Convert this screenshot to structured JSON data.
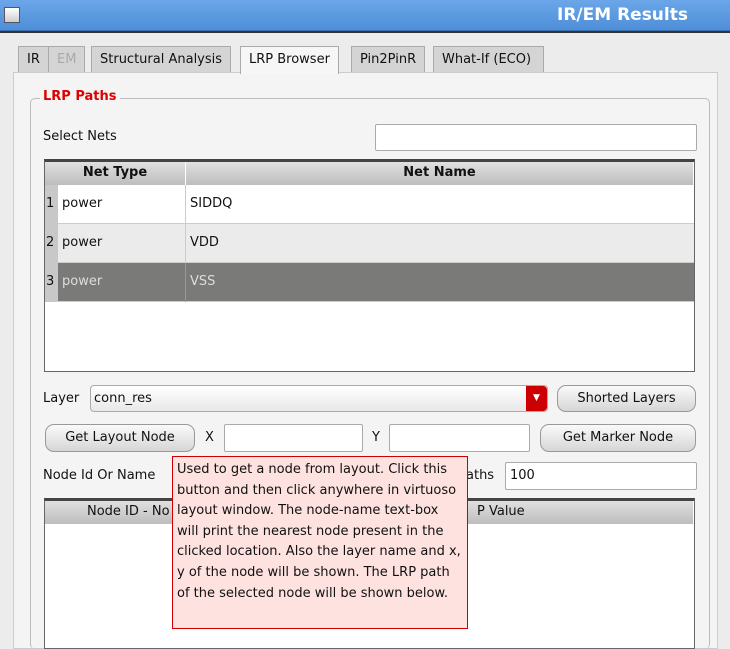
{
  "window": {
    "title": "IR/EM Results"
  },
  "tabs": [
    {
      "label": "IR"
    },
    {
      "label": "EM",
      "disabled": true
    },
    {
      "label": "Structural Analysis"
    },
    {
      "label": "LRP Browser",
      "active": true
    },
    {
      "label": "Pin2PinR"
    },
    {
      "label": "What-If (ECO)"
    }
  ],
  "group": {
    "title": "LRP Paths"
  },
  "select_nets": {
    "label": "Select Nets",
    "value": ""
  },
  "nets_table": {
    "headers": [
      "Net Type",
      "Net Name"
    ],
    "rows": [
      {
        "num": "1",
        "type": "power",
        "name": "SIDDQ"
      },
      {
        "num": "2",
        "type": "power",
        "name": "VDD"
      },
      {
        "num": "3",
        "type": "power",
        "name": "VSS",
        "selected": true
      }
    ]
  },
  "layer": {
    "label": "Layer",
    "value": "conn_res",
    "shorted_button": "Shorted Layers"
  },
  "layout": {
    "get_layout_button": "Get Layout Node",
    "x_label": "X",
    "x_value": "",
    "y_label": "Y",
    "y_value": "",
    "get_marker_button": "Get Marker Node"
  },
  "node": {
    "label": "Node Id Or Name",
    "paths_label_fragment": "aths",
    "paths_value": "100"
  },
  "paths_table": {
    "header_left_fragment": "Node ID - No",
    "header_right_fragment": "P Value"
  },
  "tooltip": {
    "text": "Used to get a node from layout. Click this button and then click anywhere in virtuoso layout window. The node-name text-box will print the nearest node present in the clicked location. Also the layer name and x, y of the node will be shown. The LRP path of the selected node will be shown below."
  },
  "colors": {
    "accent": "#cc0000",
    "selected_row": "#7a7a78",
    "tooltip_bg": "#fde2e0",
    "titlebar": "#5a9ae0"
  }
}
